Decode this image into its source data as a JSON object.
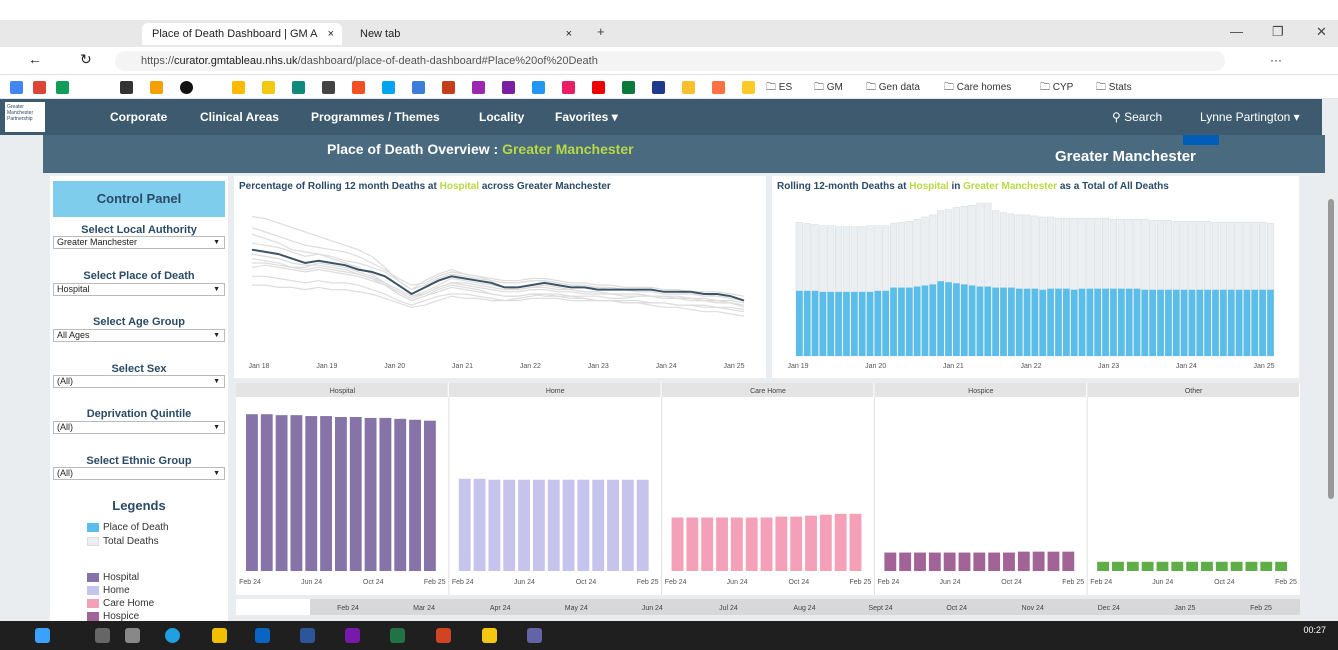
{
  "browser": {
    "tabs": [
      {
        "title": "Place of Death Dashboard | GM A",
        "close": "×",
        "active": true
      },
      {
        "title": "New tab",
        "close": "×",
        "active": false
      }
    ],
    "new_tab": "+",
    "url_prefix": "https://",
    "url_domain": "curator.gmtableau.nhs.uk",
    "url_path": "/dashboard/place-of-death-dashboard#Place%20of%20Death",
    "bookmark_folders": [
      "ES",
      "GM",
      "Gen data",
      "Care homes",
      "CYP",
      "Stats"
    ],
    "window_controls": {
      "minimize": "—",
      "restore": "❐",
      "close": "✕"
    },
    "nav_glyphs": {
      "back": "←",
      "reload": "↻",
      "menu": "···"
    }
  },
  "nav": {
    "logo_text": "Greater Manchester Partnership",
    "items": [
      "Corporate",
      "Clinical Areas",
      "Programmes / Themes",
      "Locality"
    ],
    "favorites": "Favorites ▾",
    "search": "Search",
    "user": "Lynne Partington ▾"
  },
  "header": {
    "title_prefix": "Place of Death Overview : ",
    "title_area": "Greater Manchester",
    "org": "Greater Manchester",
    "nhs_logo": "NHS"
  },
  "control_panel": {
    "title": "Control Panel",
    "filters": [
      {
        "label": "Select Local Authority",
        "value": "Greater Manchester"
      },
      {
        "label": "Select Place of Death",
        "value": "Hospital"
      },
      {
        "label": "Select Age Group",
        "value": "All Ages"
      },
      {
        "label": "Select Sex",
        "value": "(All)"
      },
      {
        "label": "Deprivation Quintile",
        "value": "(All)"
      },
      {
        "label": "Select Ethnic Group",
        "value": "(All)"
      }
    ],
    "legends_title": "Legends",
    "legend_items_1": [
      {
        "label": "Place of Death",
        "color": "#5bbde9"
      },
      {
        "label": "Total Deaths",
        "color": "#eceff1"
      }
    ],
    "legend_items_2": [
      {
        "label": "Hospital",
        "color": "#8674a9"
      },
      {
        "label": "Home",
        "color": "#c6c3ec"
      },
      {
        "label": "Care Home",
        "color": "#f4a0b8"
      },
      {
        "label": "Hospice",
        "color": "#a26496"
      }
    ]
  },
  "chart_data": [
    {
      "type": "line",
      "title_parts": [
        "Percentage of Rolling 12 month Deaths at ",
        "Hospital",
        " across Greater Manchester"
      ],
      "x_ticks": [
        "Jan 18",
        "Jan 19",
        "Jan 20",
        "Jan 21",
        "Jan 22",
        "Jan 23",
        "Jan 24",
        "Jan 25"
      ],
      "highlight_color": "#3b5566",
      "context_color": "#dddddd",
      "highlight": [
        78,
        77,
        76,
        74,
        72,
        73,
        72,
        71,
        69,
        68,
        66,
        62,
        58,
        61,
        64,
        66,
        65,
        64,
        63,
        61,
        61,
        62,
        63,
        62,
        61,
        61,
        60,
        60,
        60,
        60,
        60,
        59,
        59,
        59,
        58,
        58,
        57,
        55
      ],
      "background_series": [
        [
          85,
          83,
          81,
          78,
          77,
          76,
          74,
          72,
          70,
          67,
          63,
          58,
          55,
          57,
          60,
          62,
          61,
          60,
          58,
          57,
          57,
          58,
          58,
          57,
          57,
          56,
          55,
          55,
          54,
          54,
          53,
          52,
          52,
          51,
          50,
          50,
          49,
          48
        ],
        [
          70,
          71,
          70,
          69,
          68,
          69,
          68,
          67,
          66,
          64,
          62,
          58,
          55,
          57,
          59,
          61,
          60,
          59,
          58,
          57,
          57,
          58,
          57,
          57,
          56,
          56,
          55,
          55,
          55,
          55,
          54,
          54,
          53,
          53,
          52,
          52,
          51,
          50
        ],
        [
          93,
          92,
          90,
          88,
          86,
          84,
          82,
          80,
          78,
          75,
          70,
          64,
          60,
          64,
          67,
          69,
          67,
          66,
          64,
          63,
          63,
          64,
          64,
          63,
          62,
          62,
          61,
          61,
          60,
          60,
          60,
          59,
          59,
          58,
          58,
          57,
          57,
          55
        ],
        [
          74,
          73,
          72,
          70,
          70,
          72,
          71,
          70,
          68,
          66,
          63,
          60,
          57,
          59,
          62,
          65,
          64,
          63,
          62,
          61,
          60,
          61,
          62,
          61,
          60,
          59,
          59,
          58,
          58,
          58,
          57,
          57,
          56,
          56,
          55,
          55,
          54,
          53
        ],
        [
          66,
          66,
          65,
          64,
          63,
          64,
          63,
          63,
          62,
          60,
          58,
          55,
          53,
          55,
          57,
          58,
          58,
          57,
          56,
          55,
          56,
          57,
          58,
          58,
          57,
          57,
          57,
          56,
          56,
          57,
          57,
          56,
          56,
          55,
          55,
          54,
          54,
          52
        ],
        [
          81,
          80,
          79,
          77,
          75,
          76,
          75,
          73,
          72,
          70,
          68,
          64,
          60,
          62,
          65,
          67,
          66,
          65,
          64,
          63,
          63,
          64,
          64,
          63,
          62,
          61,
          61,
          60,
          60,
          59,
          59,
          58,
          58,
          58,
          57,
          57,
          56,
          55
        ],
        [
          88,
          86,
          84,
          82,
          80,
          79,
          78,
          77,
          75,
          72,
          69,
          65,
          62,
          63,
          66,
          68,
          67,
          66,
          65,
          64,
          64,
          65,
          65,
          64,
          63,
          63,
          62,
          62,
          61,
          61,
          61,
          60,
          60,
          59,
          59,
          59,
          58,
          57
        ],
        [
          76,
          75,
          74,
          72,
          71,
          71,
          70,
          69,
          67,
          65,
          62,
          59,
          56,
          58,
          61,
          63,
          63,
          62,
          61,
          60,
          60,
          61,
          61,
          60,
          60,
          59,
          59,
          58,
          58,
          58,
          57,
          57,
          57,
          56,
          56,
          55,
          55,
          54
        ],
        [
          62,
          62,
          61,
          61,
          60,
          61,
          60,
          60,
          59,
          58,
          56,
          54,
          52,
          53,
          55,
          57,
          56,
          56,
          55,
          55,
          55,
          56,
          56,
          56,
          55,
          55,
          55,
          55,
          54,
          54,
          54,
          54,
          53,
          53,
          53,
          52,
          52,
          51
        ],
        [
          72,
          72,
          71,
          70,
          69,
          70,
          69,
          68,
          67,
          65,
          63,
          60,
          57,
          58,
          61,
          63,
          62,
          61,
          60,
          59,
          59,
          60,
          60,
          59,
          59,
          58,
          58,
          58,
          57,
          57,
          57,
          56,
          56,
          56,
          55,
          55,
          54,
          53
        ]
      ]
    },
    {
      "type": "bar",
      "title_parts": [
        "Rolling 12-month Deaths at ",
        "Hospital",
        " in ",
        "Greater Manchester",
        " as a Total of All Deaths"
      ],
      "x_ticks": [
        "Jan 19",
        "Jan 20",
        "Jan 21",
        "Jan 22",
        "Jan 23",
        "Jan 24",
        "Jan 25"
      ],
      "series": [
        {
          "name": "Place of Death",
          "color": "#5bbde9",
          "values": [
            61,
            61,
            61,
            60,
            60,
            60,
            60,
            60,
            60,
            60,
            61,
            61,
            64,
            64,
            64,
            65,
            66,
            67,
            70,
            69,
            68,
            67,
            66,
            65,
            65,
            64,
            64,
            64,
            63,
            63,
            63,
            62,
            63,
            63,
            63,
            62,
            63,
            63,
            63,
            63,
            63,
            63,
            63,
            63,
            62,
            62,
            62,
            62,
            62,
            62,
            62,
            62,
            62,
            62,
            62,
            62,
            62,
            62,
            62,
            62,
            62
          ]
        },
        {
          "name": "Total Deaths",
          "color": "#eceff1",
          "values": [
            125,
            124,
            123,
            122,
            122,
            121,
            121,
            121,
            121,
            122,
            122,
            122,
            124,
            125,
            126,
            128,
            130,
            132,
            136,
            137,
            139,
            140,
            141,
            143,
            143,
            136,
            134,
            133,
            132,
            132,
            131,
            130,
            130,
            129,
            129,
            129,
            129,
            129,
            129,
            129,
            128,
            128,
            128,
            128,
            128,
            127,
            127,
            127,
            126,
            126,
            126,
            126,
            126,
            125,
            125,
            125,
            125,
            125,
            125,
            125,
            124
          ]
        }
      ]
    },
    {
      "type": "bar",
      "facets": [
        "Hospital",
        "Home",
        "Care Home",
        "Hospice",
        "Other"
      ],
      "x_ticks": [
        "Feb 24",
        "Jun 24",
        "Oct 24",
        "Feb 25"
      ],
      "facet_colors": [
        "#8674a9",
        "#c6c3ec",
        "#f4a0b8",
        "#a26496",
        "#5fad46"
      ],
      "values": [
        [
          170,
          170,
          169,
          169,
          168,
          168,
          167,
          167,
          166,
          166,
          165,
          164,
          163
        ],
        [
          100,
          100,
          99,
          99,
          99,
          99,
          99,
          99,
          99,
          99,
          99,
          99,
          99
        ],
        [
          58,
          58,
          58,
          58,
          58,
          58,
          58,
          59,
          59,
          60,
          61,
          62,
          62
        ],
        [
          20,
          20,
          20,
          20,
          20,
          20,
          20,
          20,
          20,
          21,
          21,
          21,
          21
        ],
        [
          10,
          10,
          10,
          10,
          10,
          10,
          10,
          10,
          10,
          10,
          10,
          10,
          10
        ]
      ],
      "ymax": 180
    }
  ],
  "bottom_axis": [
    "Feb 24",
    "Mar 24",
    "Apr 24",
    "May 24",
    "Jun 24",
    "Jul 24",
    "Aug 24",
    "Sept 24",
    "Oct 24",
    "Nov 24",
    "Dec 24",
    "Jan 25",
    "Feb 25"
  ],
  "taskbar": {
    "time": "00:27"
  }
}
